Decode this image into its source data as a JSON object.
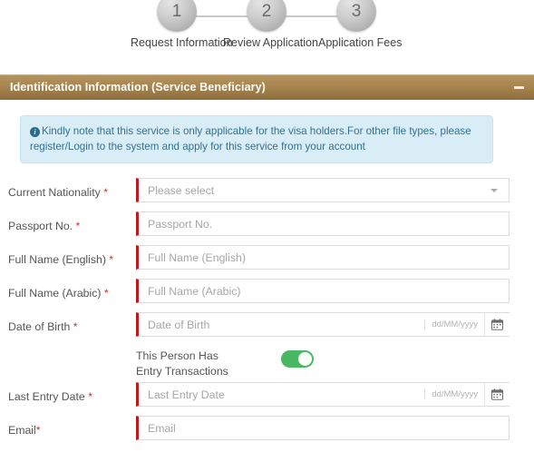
{
  "stepper": {
    "steps": [
      {
        "number": "1",
        "label": "Request Information"
      },
      {
        "number": "2",
        "label": "Review Application"
      },
      {
        "number": "3",
        "label": "Application Fees"
      }
    ]
  },
  "section": {
    "title": "Identification Information (Service Beneficiary)",
    "collapse_icon": "minus-icon"
  },
  "alert": {
    "icon": "info-circle-icon",
    "text": "Kindly note that this service is only applicable for the visa holders.For other file types, please register/Login to the system and apply for this service from your account"
  },
  "form": {
    "fields": [
      {
        "label": "Current Nationality",
        "required_mark": "*",
        "type": "select",
        "value": "Please select",
        "caret_icon": "chevron-down-icon",
        "name": "current-nationality"
      },
      {
        "label": "Passport No.",
        "required_mark": "*",
        "type": "text",
        "placeholder": "Passport No.",
        "name": "passport-no"
      },
      {
        "label": "Full Name (English)",
        "required_mark": "*",
        "type": "text",
        "placeholder": "Full Name (English)",
        "name": "full-name-english"
      },
      {
        "label": "Full Name (Arabic)",
        "required_mark": "*",
        "type": "text",
        "placeholder": "Full Name (Arabic)",
        "name": "full-name-arabic"
      },
      {
        "label": "Date of Birth",
        "required_mark": "*",
        "type": "date",
        "placeholder": "Date of Birth",
        "date_hint": "dd/MM/yyyy",
        "calendar_icon": "calendar-icon",
        "name": "date-of-birth"
      }
    ],
    "toggle": {
      "label": "This Person Has Entry Transactions",
      "state": "on",
      "color": "#49b862",
      "name": "entry-transactions-toggle"
    },
    "fields_after_toggle": [
      {
        "label": "Last Entry Date",
        "required_mark": "*",
        "type": "date",
        "placeholder": "Last Entry Date",
        "date_hint": "dd/MM/yyyy",
        "calendar_icon": "calendar-icon",
        "name": "last-entry-date"
      },
      {
        "label": "Email",
        "required_mark": "*",
        "label_no_space": true,
        "type": "text",
        "placeholder": "Email",
        "name": "email"
      }
    ]
  },
  "colors": {
    "header_gradient_start": "#b59560",
    "header_gradient_end": "#8e6e3f",
    "required_border": "#b91b21",
    "alert_bg": "#d9edf7",
    "alert_border": "#bce8f1",
    "alert_text": "#31708f",
    "toggle_on": "#49b862"
  }
}
